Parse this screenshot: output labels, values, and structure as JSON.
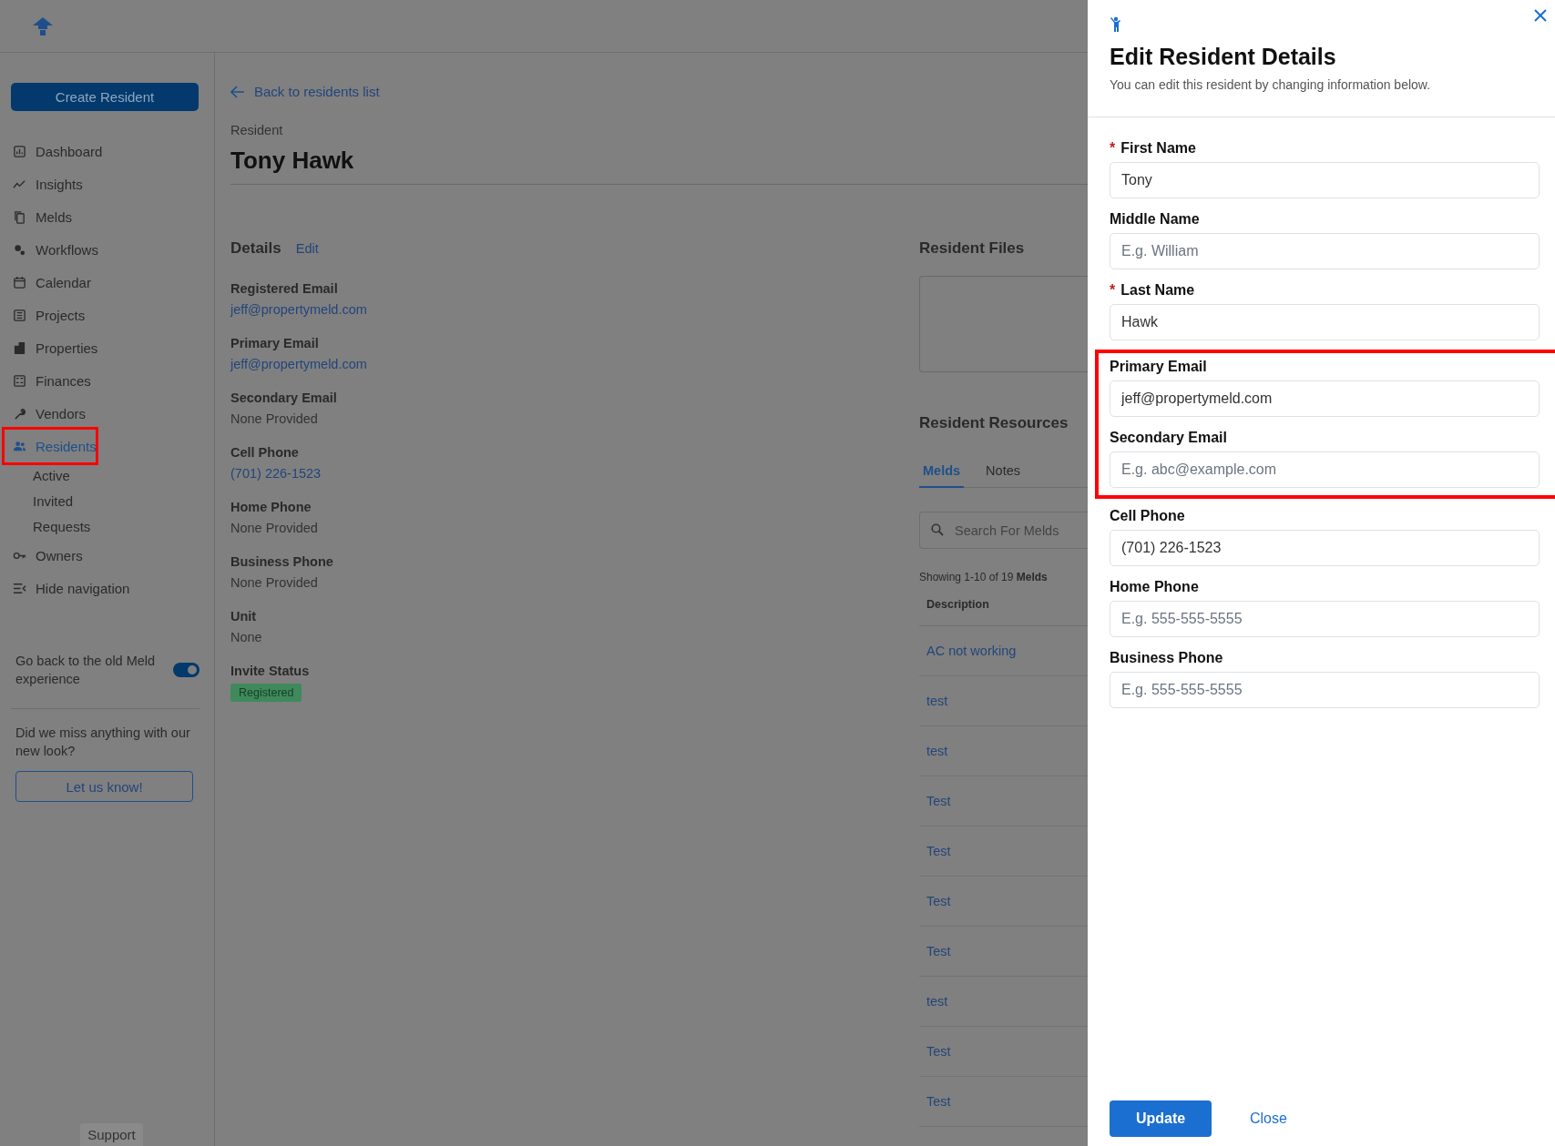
{
  "sidebar": {
    "create_button": "Create Resident",
    "items": [
      {
        "label": "Dashboard",
        "selected": false,
        "highlighted": false
      },
      {
        "label": "Insights",
        "selected": false,
        "highlighted": false
      },
      {
        "label": "Melds",
        "selected": false,
        "highlighted": false
      },
      {
        "label": "Workflows",
        "selected": false,
        "highlighted": false
      },
      {
        "label": "Calendar",
        "selected": false,
        "highlighted": false
      },
      {
        "label": "Projects",
        "selected": false,
        "highlighted": false
      },
      {
        "label": "Properties",
        "selected": false,
        "highlighted": false
      },
      {
        "label": "Finances",
        "selected": false,
        "highlighted": false
      },
      {
        "label": "Vendors",
        "selected": false,
        "highlighted": false
      },
      {
        "label": "Residents",
        "selected": true,
        "highlighted": true,
        "children": [
          "Active",
          "Invited",
          "Requests"
        ]
      },
      {
        "label": "Owners",
        "selected": false,
        "highlighted": false
      },
      {
        "label": "Hide navigation",
        "selected": false,
        "highlighted": false
      }
    ],
    "old_experience": {
      "label": "Go back to the old Meld experience",
      "on": true
    },
    "feedback": {
      "text": "Did we miss anything with our new look?",
      "button": "Let us know!"
    },
    "support": "Support"
  },
  "main": {
    "back_link": "Back to residents list",
    "eyebrow": "Resident",
    "title": "Tony Hawk",
    "details": {
      "heading": "Details",
      "edit_link": "Edit",
      "fields": [
        {
          "label": "Registered Email",
          "value": "jeff@propertymeld.com",
          "kind": "link"
        },
        {
          "label": "Primary Email",
          "value": "jeff@propertymeld.com",
          "kind": "link"
        },
        {
          "label": "Secondary Email",
          "value": "None Provided",
          "kind": "text"
        },
        {
          "label": "Cell Phone",
          "value": "(701) 226-1523",
          "kind": "link"
        },
        {
          "label": "Home Phone",
          "value": "None Provided",
          "kind": "text"
        },
        {
          "label": "Business Phone",
          "value": "None Provided",
          "kind": "text"
        },
        {
          "label": "Unit",
          "value": "None",
          "kind": "text"
        },
        {
          "label": "Invite Status",
          "value": "Registered",
          "kind": "badge"
        }
      ]
    },
    "files": {
      "heading": "Resident Files"
    },
    "resources": {
      "heading": "Resident Resources",
      "tabs": [
        {
          "label": "Melds",
          "selected": true
        },
        {
          "label": "Notes",
          "selected": false
        }
      ],
      "search": {
        "placeholder": "Search For Melds"
      },
      "showing": "Showing 1-10 of 19 **Melds**",
      "table": {
        "columns": [
          "Description"
        ],
        "rows": [
          "AC not working",
          "test",
          "test",
          "Test",
          "Test",
          "Test",
          "Test",
          "test",
          "Test",
          "Test"
        ]
      }
    }
  },
  "panel": {
    "title": "Edit Resident Details",
    "subtitle": "You can edit this resident by changing information below.",
    "fields": [
      {
        "label": "First Name",
        "required_mark": "*",
        "value": "Tony",
        "highlighted": false
      },
      {
        "label": "Middle Name",
        "placeholder": "E.g. William",
        "highlighted": false
      },
      {
        "label": "Last Name",
        "required_mark": "*",
        "value": "Hawk",
        "highlighted": false
      },
      {
        "label": "Primary Email",
        "value": "jeff@propertymeld.com",
        "highlighted": true
      },
      {
        "label": "Secondary Email",
        "placeholder": "E.g. abc@example.com",
        "highlighted": true
      },
      {
        "label": "Cell Phone",
        "value": "(701) 226-1523",
        "highlighted": false
      },
      {
        "label": "Home Phone",
        "placeholder": "E.g. 555-555-5555",
        "highlighted": false
      },
      {
        "label": "Business Phone",
        "placeholder": "E.g. 555-555-5555",
        "highlighted": false
      }
    ],
    "buttons": [
      {
        "label": "Update",
        "kind": "primary"
      },
      {
        "label": "Close",
        "kind": "link"
      }
    ]
  }
}
